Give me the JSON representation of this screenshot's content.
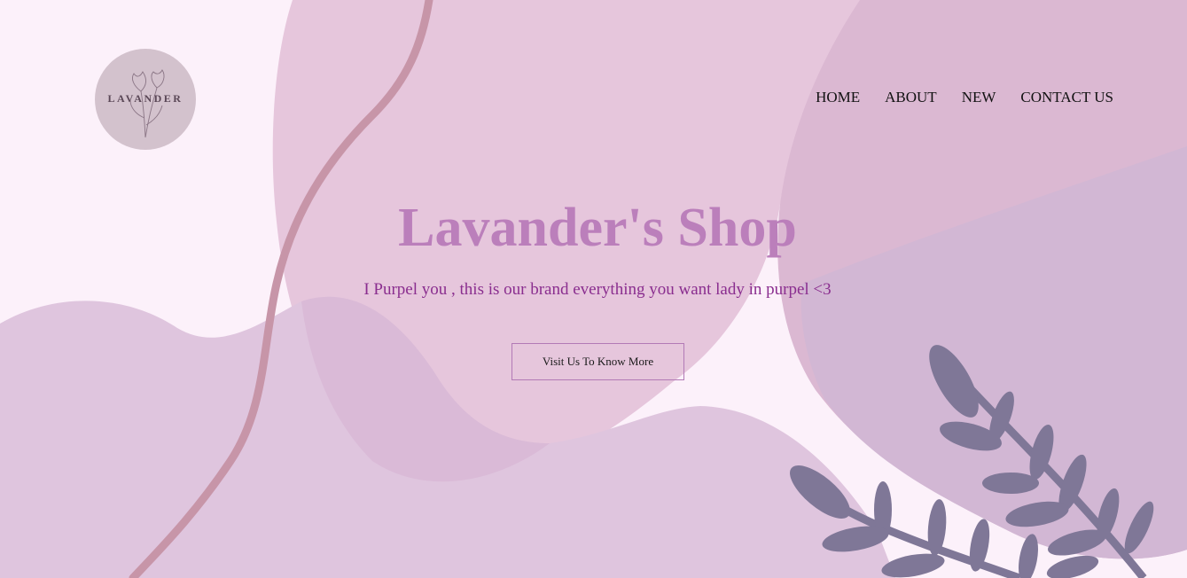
{
  "brand": {
    "logo_text": "LAVANDER"
  },
  "nav": {
    "items": [
      {
        "label": "HOME"
      },
      {
        "label": "ABOUT"
      },
      {
        "label": "NEW"
      },
      {
        "label": "CONTACT US"
      }
    ]
  },
  "hero": {
    "title": "Lavander's Shop",
    "subtitle": "I Purpel you , this is our brand everything you want lady in purpel <3",
    "cta_label": "Visit Us To Know More"
  },
  "colors": {
    "background": "#fcf1fa",
    "title": "#bb7fbb",
    "subtitle": "#8a2e8f",
    "leaf": "#7f7797",
    "stroke": "#c795a8"
  },
  "icons": {
    "logo": "tulip-flower-icon",
    "decoration": "leaf-branch-icon"
  }
}
